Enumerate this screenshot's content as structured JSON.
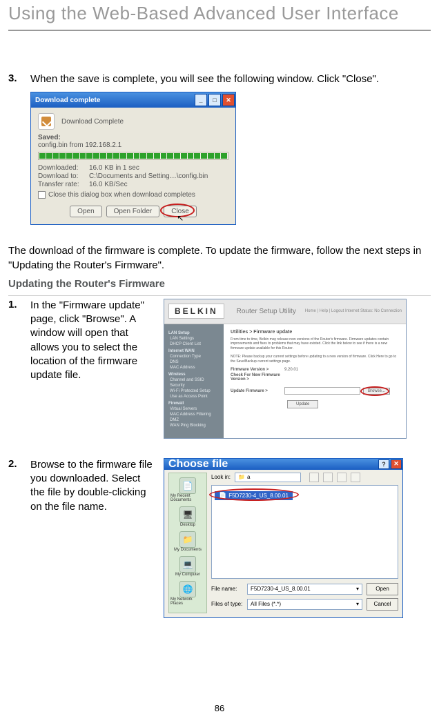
{
  "page_header": "Using the Web-Based Advanced User Interface",
  "page_number": "86",
  "step3": {
    "num": "3.",
    "text": "When the save is complete, you will see the following window. Click \"Close\"."
  },
  "download_dialog": {
    "title": "Download complete",
    "main_text": "Download Complete",
    "saved_label": "Saved:",
    "saved_value": "config.bin from 192.168.2.1",
    "downloaded_label": "Downloaded:",
    "downloaded_value": "16.0 KB in 1 sec",
    "downloadto_label": "Download to:",
    "downloadto_value": "C:\\Documents and Setting…\\config.bin",
    "transfer_label": "Transfer rate:",
    "transfer_value": "16.0 KB/Sec",
    "checkbox_label": "Close this dialog box when download completes",
    "open_btn": "Open",
    "open_folder_btn": "Open Folder",
    "close_btn": "Close"
  },
  "post_download_text": "The download of the firmware is complete. To update the firmware, follow the next steps in \"Updating the Router's Firmware\".",
  "subheading": "Updating the Router's Firmware",
  "step1": {
    "num": "1.",
    "text": "In the \"Firmware update\" page, click \"Browse\". A window will open that allows you to select the location of the firmware update file."
  },
  "router_screen": {
    "logo": "BELKIN",
    "title": "Router Setup Utility",
    "meta": "Home | Help | Logout    Internet Status: No Connection",
    "crumb": "Utilities > Firmware update",
    "desc": "From time to time, Belkin may release new versions of the Router's firmware. Firmware updates contain improvements and fixes to problems that may have existed. Click the link below to see if there is a new firmware update available for this Router.",
    "note": "NOTE: Please backup your current settings before updating to a new version of firmware. Click Here to go to the Save/Backup current settings page.",
    "fw_version_label": "Firmware Version >",
    "fw_version_value": "9.20.01",
    "check_label": "Check For New Firmware Version >",
    "update_label": "Update Firmware >",
    "browse_btn": "Browse...",
    "update_btn": "Update",
    "sidebar": {
      "lan_setup": "LAN Setup",
      "items1": [
        "LAN Settings",
        "DHCP Client List"
      ],
      "internet_wan": "Internet WAN",
      "items2": [
        "Connection Type",
        "DNS",
        "MAC Address"
      ],
      "wireless": "Wireless",
      "items3": [
        "Channel and SSID",
        "Security",
        "Wi-Fi Protected Setup",
        "Use as Access Point"
      ],
      "firewall": "Firewall",
      "items4": [
        "Virtual Servers",
        "MAC Address Filtering",
        "DMZ",
        "WAN Ping Blocking"
      ]
    }
  },
  "step2": {
    "num": "2.",
    "text": "Browse to the firmware file you downloaded. Select the file by double-clicking on the file name."
  },
  "choose_dialog": {
    "title": "Choose file",
    "lookin_label": "Look in:",
    "lookin_value": "a",
    "file_item": "F5D7230-4_US_8.00.01",
    "filename_label": "File name:",
    "filename_value": "F5D7230-4_US_8.00.01",
    "filetype_label": "Files of type:",
    "filetype_value": "All Files (*.*)",
    "open_btn": "Open",
    "cancel_btn": "Cancel",
    "places": [
      "My Recent Documents",
      "Desktop",
      "My Documents",
      "My Computer",
      "My Network Places"
    ]
  }
}
